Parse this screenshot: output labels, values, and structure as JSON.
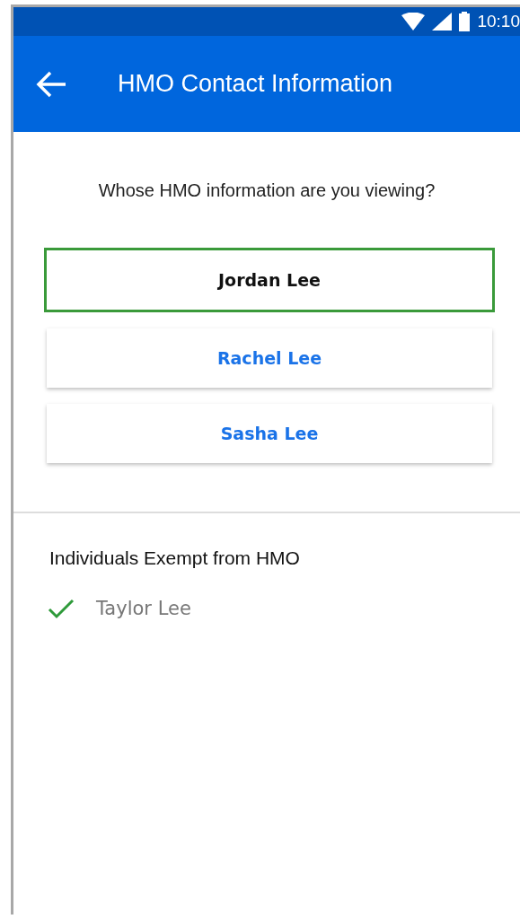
{
  "status_bar": {
    "time": "10:10"
  },
  "app_bar": {
    "title": "HMO Contact Information"
  },
  "question": "Whose HMO information are you viewing?",
  "people": [
    {
      "name": "Jordan Lee",
      "selected": true
    },
    {
      "name": "Rachel Lee",
      "selected": false
    },
    {
      "name": "Sasha Lee",
      "selected": false
    }
  ],
  "exempt": {
    "heading": "Individuals Exempt from HMO",
    "items": [
      {
        "name": "Taylor Lee",
        "checked": true
      }
    ]
  }
}
